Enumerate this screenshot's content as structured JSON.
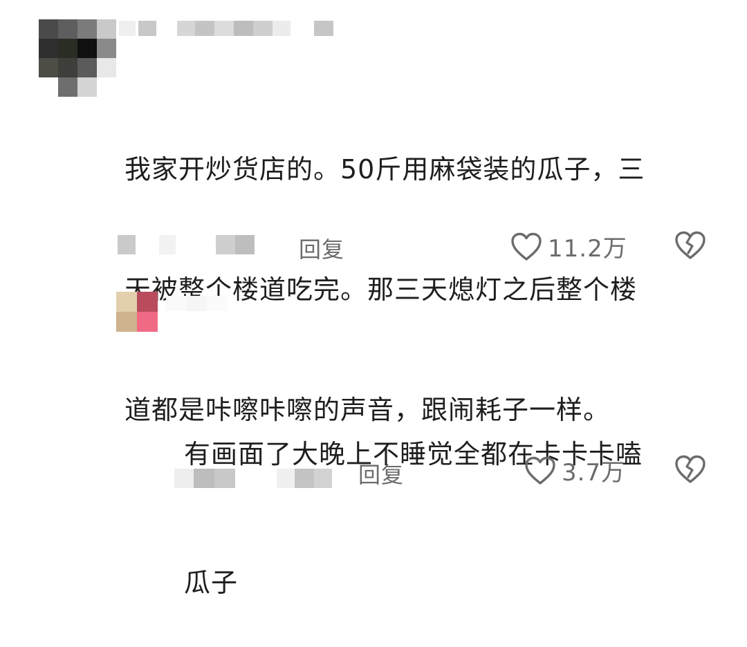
{
  "comment1": {
    "text_lines": [
      "我家开炒货店的。50斤用麻袋装的瓜子，三",
      "天被整个楼道吃完。那三天熄灯之后整个楼",
      "道都是咔嚓咔嚓的声音，跟闹耗子一样。"
    ],
    "reply_label": "回复",
    "like_count": "11.2万"
  },
  "comment2": {
    "text_lines": [
      "有画面了大晚上不睡觉全都在卡卡卡嗑",
      "瓜子"
    ],
    "reply_label": "回复",
    "like_count": "3.7万"
  },
  "colors": {
    "text": "#1e1e1e",
    "meta": "#6b6b6b",
    "background": "#ffffff"
  },
  "icons": [
    "heart-outline-icon",
    "broken-heart-icon"
  ]
}
